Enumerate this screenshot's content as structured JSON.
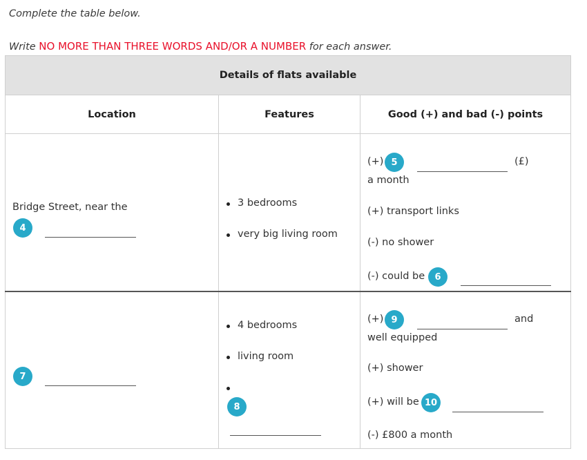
{
  "instructions": {
    "line1": "Complete the table below.",
    "line2_pre": "Write ",
    "line2_emph": "NO MORE THAN THREE WORDS AND/OR A NUMBER",
    "line2_post": " for each answer."
  },
  "table": {
    "title": "Details of flats available",
    "headers": {
      "location": "Location",
      "features": "Features",
      "points": "Good (+) and bad (-) points"
    },
    "row1": {
      "location_text": "Bridge Street, near the",
      "location_q": "4",
      "features": [
        "3 bedrooms",
        "very big living room"
      ],
      "points": {
        "p1_prefix": "(+)",
        "p1_q": "5",
        "p1_suffix": "(£)",
        "p1_line2": "a month",
        "p2": "(+) transport links",
        "p3": "(-) no shower",
        "p4_prefix": "(-) could be",
        "p4_q": "6"
      }
    },
    "row2": {
      "location_q": "7",
      "features": [
        "4 bedrooms",
        "living room"
      ],
      "feature3_q": "8",
      "points": {
        "p1_prefix": "(+)",
        "p1_q": "9",
        "p1_suffix": "and",
        "p1_line2": "well equipped",
        "p2": "(+) shower",
        "p3_prefix": "(+) will be",
        "p3_q": "10",
        "p4": "(-) £800 a month"
      }
    }
  },
  "colors": {
    "accent_badge": "#28a9c9",
    "emphasis_red": "#e8102a",
    "header_bg": "#e2e2e2"
  }
}
